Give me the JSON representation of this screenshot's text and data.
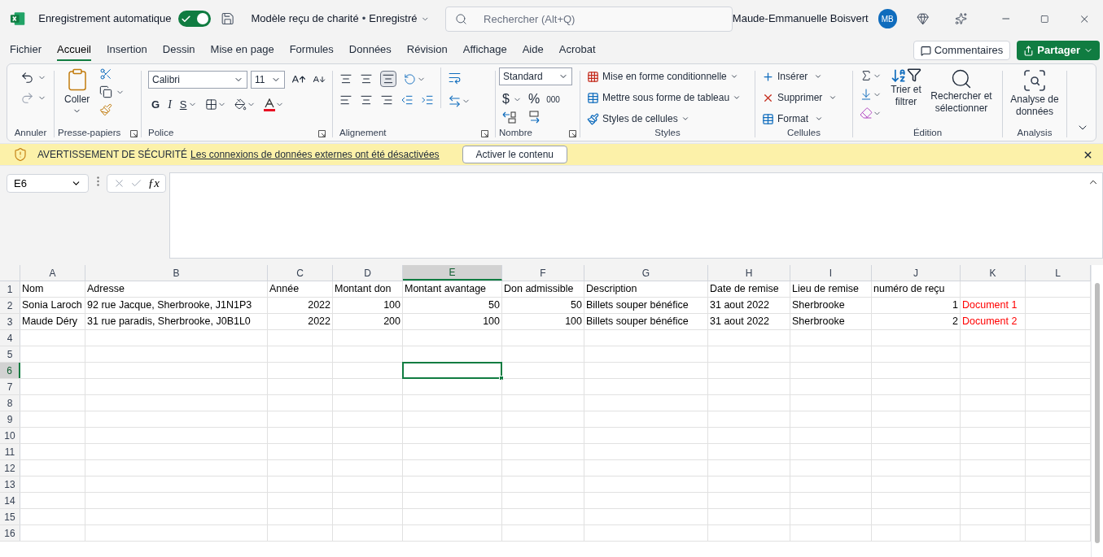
{
  "titlebar": {
    "autosave_label": "Enregistrement automatique",
    "autosave_on": true,
    "doc_title": "Modèle reçu de charité",
    "title_separator": "•",
    "save_status": "Enregistré",
    "search_placeholder": "Rechercher (Alt+Q)",
    "user_name": "Maude-Emmanuelle Boisvert",
    "user_initials": "MB"
  },
  "menu_tabs": [
    {
      "label": "Fichier",
      "selected": false
    },
    {
      "label": "Accueil",
      "selected": true
    },
    {
      "label": "Insertion",
      "selected": false
    },
    {
      "label": "Dessin",
      "selected": false
    },
    {
      "label": "Mise en page",
      "selected": false
    },
    {
      "label": "Formules",
      "selected": false
    },
    {
      "label": "Données",
      "selected": false
    },
    {
      "label": "Révision",
      "selected": false
    },
    {
      "label": "Affichage",
      "selected": false
    },
    {
      "label": "Aide",
      "selected": false
    },
    {
      "label": "Acrobat",
      "selected": false
    }
  ],
  "comments_button": "Commentaires",
  "share_button": "Partager",
  "ribbon": {
    "undo": {
      "label": "Annuler"
    },
    "clipboard": {
      "label": "Presse-papiers",
      "paste": "Coller"
    },
    "font": {
      "label": "Police",
      "name": "Calibri",
      "size": "11",
      "bold": "G",
      "italic": "I",
      "underline": "S"
    },
    "alignment": {
      "label": "Alignement"
    },
    "number": {
      "label": "Nombre",
      "format": "Standard",
      "currency": "$",
      "percent": "%",
      "thousands": "000"
    },
    "styles": {
      "label": "Styles",
      "items": [
        "Mise en forme conditionnelle",
        "Mettre sous forme de tableau",
        "Styles de cellules"
      ]
    },
    "cells": {
      "label": "Cellules",
      "items": [
        "Insérer",
        "Supprimer",
        "Format"
      ]
    },
    "editing": {
      "label": "Édition",
      "sort": "Trier et filtrer",
      "find": "Rechercher et sélectionner"
    },
    "analysis": {
      "label": "Analysis",
      "button": "Analyse de données"
    }
  },
  "warning": {
    "title": "AVERTISSEMENT DE SÉCURITÉ",
    "message": "Les connexions de données externes ont été désactivées",
    "button": "Activer le contenu"
  },
  "formula_bar": {
    "name_box": "E6",
    "function_button": "ƒx"
  },
  "sheet": {
    "columns": [
      {
        "label": "A",
        "selected": false
      },
      {
        "label": "B",
        "selected": false
      },
      {
        "label": "C",
        "selected": false
      },
      {
        "label": "D",
        "selected": false
      },
      {
        "label": "E",
        "selected": true
      },
      {
        "label": "F",
        "selected": false
      },
      {
        "label": "G",
        "selected": false
      },
      {
        "label": "H",
        "selected": false
      },
      {
        "label": "I",
        "selected": false
      },
      {
        "label": "J",
        "selected": false
      },
      {
        "label": "K",
        "selected": false
      },
      {
        "label": "L",
        "selected": false
      }
    ],
    "rows": [
      {
        "number": "1",
        "selected": false,
        "cells": [
          {
            "text": "Nom",
            "kind": "text"
          },
          {
            "text": "Adresse",
            "kind": "text"
          },
          {
            "text": "Année",
            "kind": "text"
          },
          {
            "text": "Montant don",
            "kind": "text"
          },
          {
            "text": "Montant avantage",
            "kind": "text"
          },
          {
            "text": "Don admissible",
            "kind": "text"
          },
          {
            "text": "Description",
            "kind": "text"
          },
          {
            "text": "Date de remise",
            "kind": "text"
          },
          {
            "text": "Lieu de remise",
            "kind": "text"
          },
          {
            "text": "numéro de reçu",
            "kind": "text"
          },
          null,
          null
        ]
      },
      {
        "number": "2",
        "selected": false,
        "cells": [
          {
            "text": "Sonia Laroch",
            "kind": "text"
          },
          {
            "text": "92 rue Jacque, Sherbrooke, J1N1P3",
            "kind": "text"
          },
          {
            "text": "2022",
            "kind": "number"
          },
          {
            "text": "100",
            "kind": "number"
          },
          {
            "text": "50",
            "kind": "number"
          },
          {
            "text": "50",
            "kind": "number"
          },
          {
            "text": "Billets souper bénéfice",
            "kind": "text"
          },
          {
            "text": "31 aout 2022",
            "kind": "text"
          },
          {
            "text": "Sherbrooke",
            "kind": "text"
          },
          {
            "text": "1",
            "kind": "number"
          },
          {
            "text": "Document 1",
            "kind": "text",
            "color": "#ff0000"
          },
          null
        ]
      },
      {
        "number": "3",
        "selected": false,
        "cells": [
          {
            "text": "Maude Déry",
            "kind": "text"
          },
          {
            "text": "31 rue paradis, Sherbrooke, J0B1L0",
            "kind": "text"
          },
          {
            "text": "2022",
            "kind": "number"
          },
          {
            "text": "200",
            "kind": "number"
          },
          {
            "text": "100",
            "kind": "number"
          },
          {
            "text": "100",
            "kind": "number"
          },
          {
            "text": "Billets souper bénéfice",
            "kind": "text"
          },
          {
            "text": "31 aout 2022",
            "kind": "text"
          },
          {
            "text": "Sherbrooke",
            "kind": "text"
          },
          {
            "text": "2",
            "kind": "number"
          },
          {
            "text": "Document 2",
            "kind": "text",
            "color": "#ff0000"
          },
          null
        ]
      },
      {
        "number": "4",
        "selected": false,
        "cells": []
      },
      {
        "number": "5",
        "selected": false,
        "cells": []
      },
      {
        "number": "6",
        "selected": true,
        "cells": []
      },
      {
        "number": "7",
        "selected": false,
        "cells": []
      },
      {
        "number": "8",
        "selected": false,
        "cells": []
      },
      {
        "number": "9",
        "selected": false,
        "cells": []
      },
      {
        "number": "10",
        "selected": false,
        "cells": []
      },
      {
        "number": "11",
        "selected": false,
        "cells": []
      },
      {
        "number": "12",
        "selected": false,
        "cells": []
      },
      {
        "number": "13",
        "selected": false,
        "cells": []
      },
      {
        "number": "14",
        "selected": false,
        "cells": []
      },
      {
        "number": "15",
        "selected": false,
        "cells": []
      },
      {
        "number": "16",
        "selected": false,
        "cells": []
      }
    ]
  }
}
